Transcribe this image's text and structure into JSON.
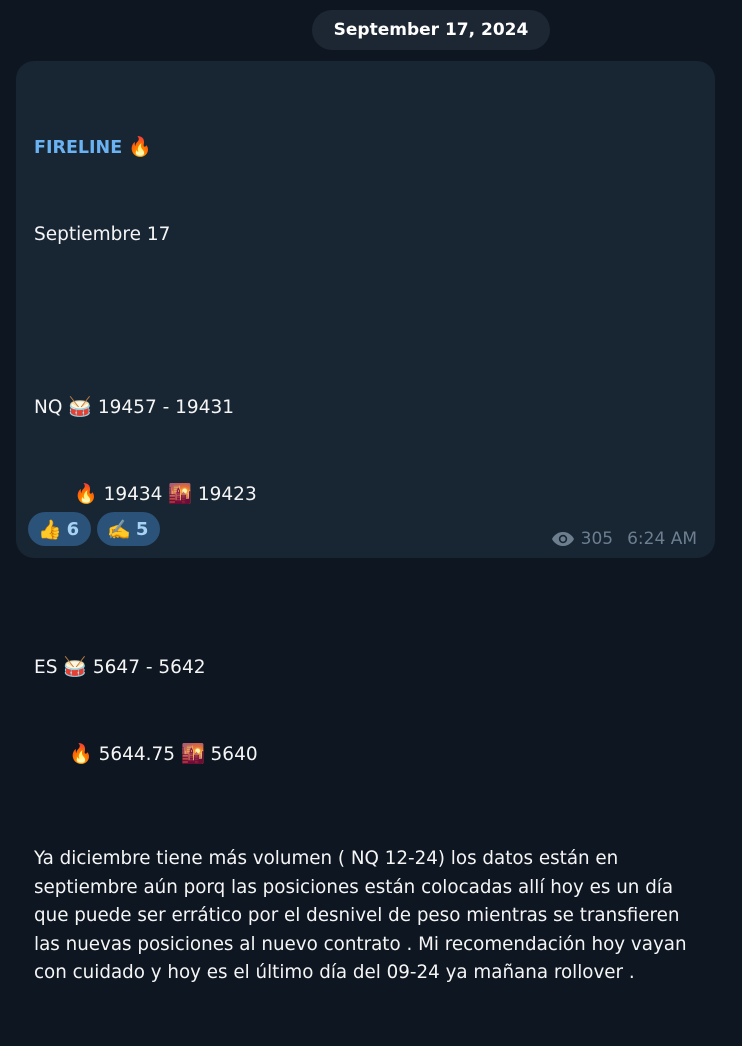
{
  "date_separator": "September 17, 2024",
  "message": {
    "sender": "FIRELINE",
    "sender_emoji": "🔥",
    "lines": {
      "date_line": "Septiembre 17",
      "nq_label": "NQ",
      "nq_range": "19457 - 19431",
      "nq_fire_value": "19434",
      "nq_sunrise_value": "19423",
      "es_label": "ES",
      "es_range": "5647 - 5642",
      "es_fire_value": "5644.75",
      "es_sunrise_value": "5640"
    },
    "emoji": {
      "drum": "🥁",
      "fire": "🔥",
      "sunrise": "🌇"
    },
    "paragraph": "Ya diciembre tiene más volumen ( NQ 12-24) los datos están en septiembre aún porq las posiciones están colocadas allí hoy es un día que puede ser errático por el desnivel de peso mientras se transfieren las nuevas posiciones al nuevo contrato . Mi recomendación hoy vayan con cuidado y hoy es el último día del 09-24 ya mañana rollover ."
  },
  "reactions": [
    {
      "emoji": "👍",
      "count": "6"
    },
    {
      "emoji": "✍️",
      "count": "5"
    }
  ],
  "meta": {
    "views": "305",
    "time": "6:24 AM"
  },
  "colors": {
    "background": "#0e1621",
    "bubble": "#182533",
    "sender": "#6ab2f2",
    "reaction_bg": "#2b5278",
    "reaction_text": "#a7d1f5",
    "meta": "#6d7f8f"
  }
}
